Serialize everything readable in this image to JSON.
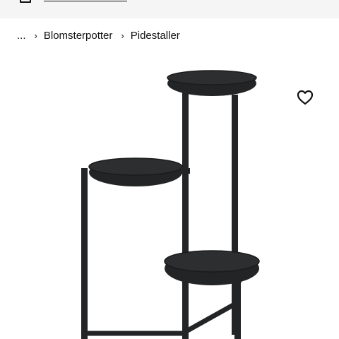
{
  "breadcrumb": {
    "ellipsis": "...",
    "items": [
      "Blomsterpotter",
      "Pidestaller"
    ]
  },
  "icons": {
    "store": "store-icon",
    "separator": "chevron-right-icon",
    "favourite": "heart-icon"
  },
  "colors": {
    "stand": "#222426",
    "top_strip": "#f5f5f5",
    "text": "#111111"
  }
}
